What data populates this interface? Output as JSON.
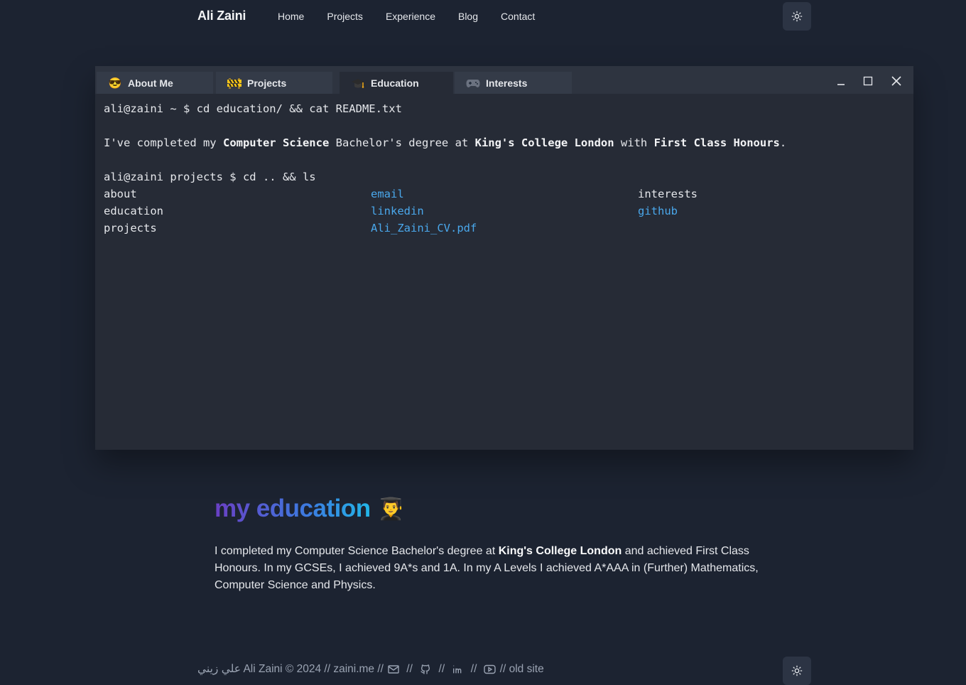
{
  "nav": {
    "brand": "Ali Zaini",
    "links": [
      "Home",
      "Projects",
      "Experience",
      "Blog",
      "Contact"
    ],
    "theme_icon": "sun-icon"
  },
  "terminal": {
    "tabs": [
      {
        "label": "About Me",
        "icon": "sunglasses-emoji"
      },
      {
        "label": "Projects",
        "icon": "construction-emoji"
      },
      {
        "label": "Education",
        "icon": "graduation-cap-emoji"
      },
      {
        "label": "Interests",
        "icon": "game-controller-emoji"
      }
    ],
    "active_tab": "Education",
    "cmd1": "ali@zaini ~ $ cd education/ && cat README.txt",
    "readme": {
      "p1": "I've completed my ",
      "b1": "Computer Science",
      "p2": " Bachelor's degree at ",
      "b2": "King's College London",
      "p3": " with ",
      "b3": "First Class Honours",
      "p4": "."
    },
    "cmd2": "ali@zaini projects $ cd .. && ls",
    "ls": {
      "col1": [
        "about",
        "education",
        "projects"
      ],
      "col2": [
        "email",
        "linkedin",
        "Ali_Zaini_CV.pdf"
      ],
      "col3": [
        "interests",
        "github"
      ]
    }
  },
  "content": {
    "heading": "my education",
    "heading_emoji": "👨‍🎓",
    "para": {
      "p1": "I completed my Computer Science Bachelor's degree at ",
      "b1": "King's College London",
      "p2": " and achieved First Class Honours. In my GCSEs, I achieved 9A*s and 1A. In my A Levels I achieved A*AAA in (Further) Mathematics, Computer Science and Physics."
    }
  },
  "footer": {
    "arabic_name": "علي زيني",
    "copyright": " Ali Zaini © 2024 // zaini.me //",
    "sep": " // ",
    "old_site": "// old site",
    "icons": [
      "mail-icon",
      "github-icon",
      "linkedin-icon",
      "youtube-icon"
    ]
  },
  "colors": {
    "background": "#1c2331",
    "terminal": "#262b36",
    "link": "#4aa8ec"
  }
}
